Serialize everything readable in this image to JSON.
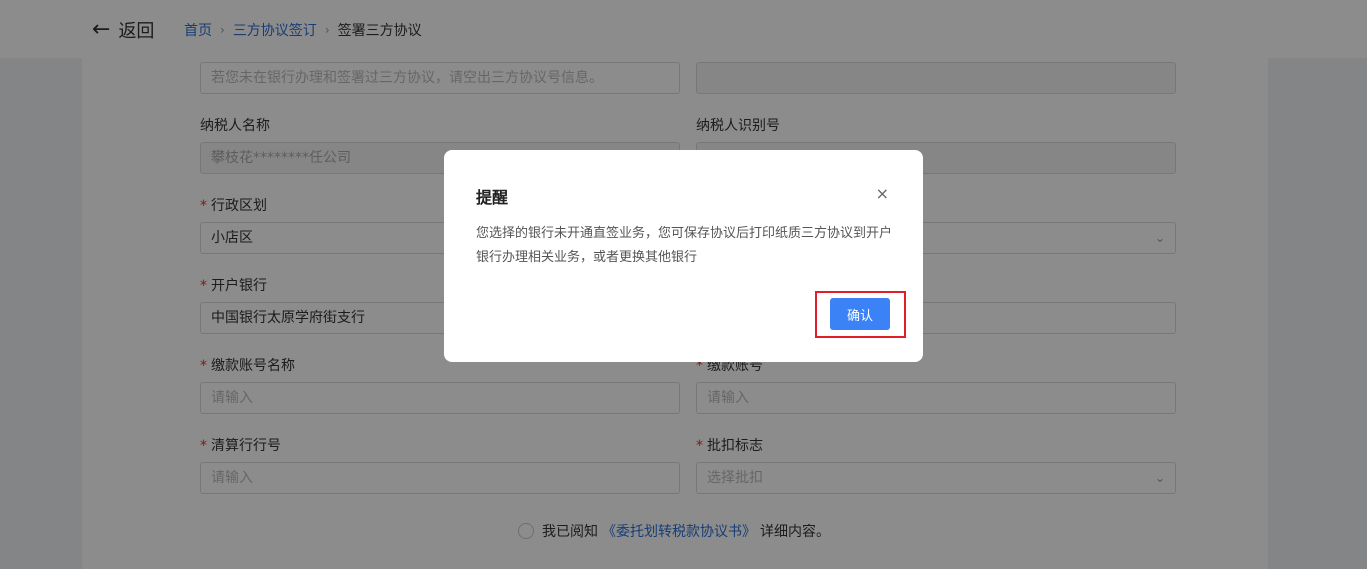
{
  "header": {
    "back_label": "返回",
    "breadcrumb": [
      "首页",
      "三方协议签订",
      "签署三方协议"
    ]
  },
  "form": {
    "top_left_placeholder": "若您未在银行办理和签署过三方协议，请空出三方协议号信息。",
    "taxpayer_name_label": "纳税人名称",
    "taxpayer_name_value": "攀枝花********任公司",
    "taxpayer_id_label": "纳税人识别号",
    "admin_region_label": "行政区划",
    "admin_region_value": "小店区",
    "bank_label": "开户银行",
    "bank_value": "中国银行太原学府街支行",
    "account_name_label": "缴款账号名称",
    "account_name_placeholder": "请输入",
    "account_no_label": "缴款账号",
    "account_no_placeholder": "请输入",
    "clearing_bank_label": "清算行行号",
    "clearing_bank_placeholder": "请输入",
    "debit_flag_label": "批扣标志",
    "debit_flag_placeholder": "选择批扣",
    "required_mark": "*",
    "agree_prefix": "我已阅知",
    "agree_link": "《委托划转税款协议书》",
    "agree_suffix": "详细内容。"
  },
  "dialog": {
    "title": "提醒",
    "close_glyph": "×",
    "message": "您选择的银行未开通直签业务，您可保存协议后打印纸质三方协议到开户银行办理相关业务，或者更换其他银行",
    "confirm_label": "确认"
  },
  "colors": {
    "link": "#2d6fd6",
    "primary_button": "#3b82f6",
    "required": "#f5222d",
    "highlight_box": "#e11d2a"
  },
  "icons": {
    "back": "arrow-left-icon",
    "breadcrumb_separator": "chevron-right-icon",
    "select_chevron": "chevron-down-icon",
    "close": "close-icon"
  }
}
